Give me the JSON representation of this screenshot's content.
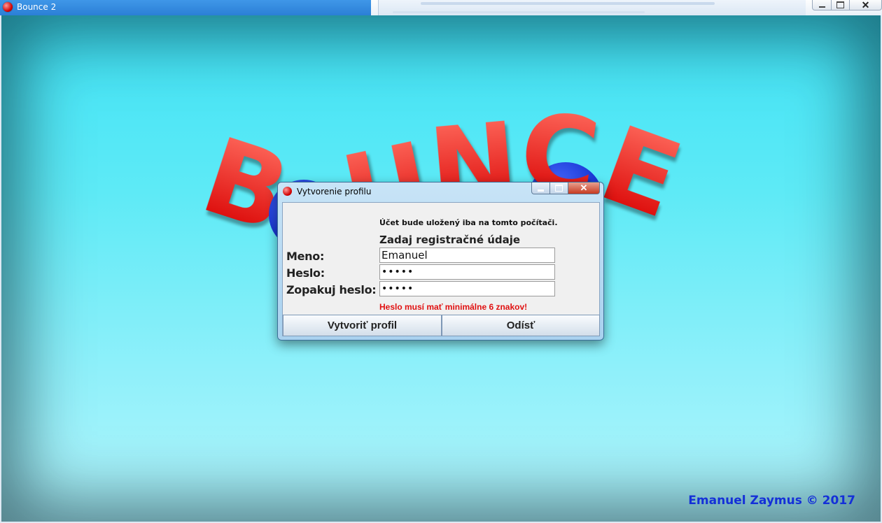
{
  "window": {
    "title": "Bounce 2",
    "close_glyph": "✕"
  },
  "game": {
    "logo_letters": [
      "B",
      "U",
      "N",
      "C",
      "E"
    ],
    "credit": "Emanuel Zaymus © 2017"
  },
  "dialog": {
    "title": "Vytvorenie profilu",
    "close_glyph": "✕",
    "notice": "Účet bude uložený iba na tomto počítači.",
    "heading": "Zadaj registračné údaje",
    "fields": {
      "name_label": "Meno:",
      "name_value": "Emanuel",
      "password_label": "Heslo:",
      "password_value": "•••••",
      "repeat_label": "Zopakuj heslo:",
      "repeat_value": "•••••"
    },
    "error": "Heslo musí mať minimálne 6 znakov!",
    "buttons": {
      "create": "Vytvoriť profil",
      "quit": "Odísť"
    }
  },
  "colors": {
    "accent_red": "#d80000",
    "credit_blue": "#1430d8",
    "error_red": "#e01010"
  }
}
